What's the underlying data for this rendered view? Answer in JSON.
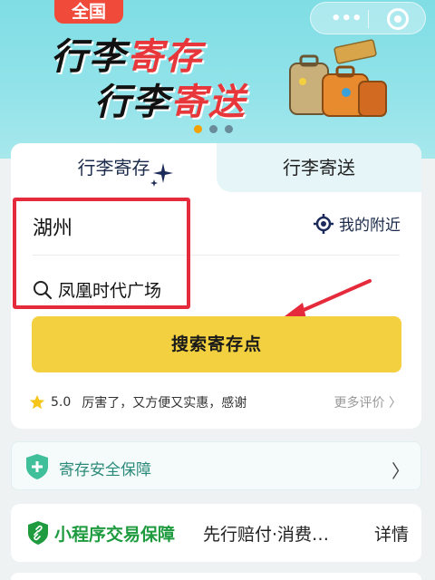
{
  "banner": {
    "badge": "全国",
    "line1_a": "行李",
    "line1_b": "寄存",
    "line2_a": "行李",
    "line2_b": "寄送",
    "capsule_more": "•••"
  },
  "tabs": [
    {
      "label": "行李寄存"
    },
    {
      "label": "行李寄送"
    }
  ],
  "form": {
    "city": "湖州",
    "nearby_label": "我的附近",
    "search_value": "凤凰时代广场",
    "submit_label": "搜索寄存点"
  },
  "review": {
    "score": "5.0",
    "text": "厉害了，又方便又实惠，感谢",
    "more": "更多评价 〉"
  },
  "safety": {
    "label": "寄存安全保障",
    "chevron": "〉"
  },
  "guarantee": {
    "title": "小程序交易保障",
    "desc": "先行赔付·消费…",
    "detail": "详情"
  },
  "colors": {
    "accent_yellow": "#f2d040",
    "highlight_red": "#e52a3b",
    "tab_bg": "#e6f6f8",
    "guarantee_green": "#1f9b3f",
    "safety_teal": "#2a8a7a"
  }
}
